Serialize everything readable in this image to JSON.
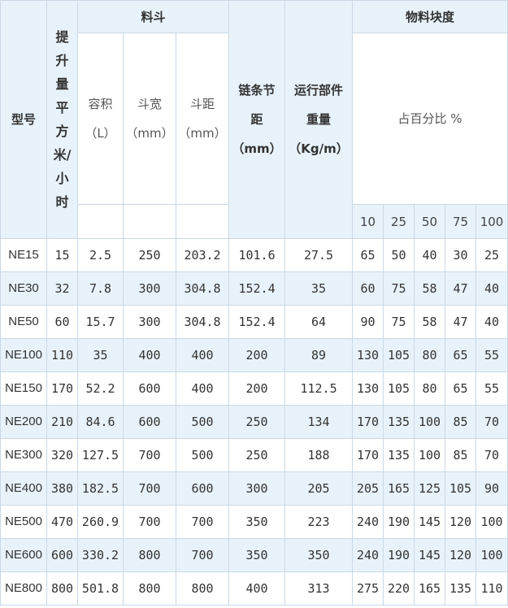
{
  "headers": {
    "model": "型号",
    "lift_chars": [
      "提",
      "升",
      "量",
      "平",
      "方",
      "米/",
      "小",
      "时"
    ],
    "hopper_group": "料斗",
    "volume": [
      "容积",
      "（L）"
    ],
    "width": [
      "斗宽",
      "（mm）"
    ],
    "spacing": [
      "斗距",
      "（mm）"
    ],
    "chain_pitch": [
      "链条节",
      "距",
      "（mm）"
    ],
    "weight": [
      "运行部件",
      "重量",
      "（Kg/m）"
    ],
    "lump_group": "物料块度",
    "percent": "占百分比 %",
    "percent_cols": [
      "10",
      "25",
      "50",
      "75",
      "100"
    ]
  },
  "rows": [
    [
      "NE15",
      "15",
      "2.5",
      "250",
      "203.2",
      "101.6",
      "27.5",
      "65",
      "50",
      "40",
      "30",
      "25"
    ],
    [
      "NE30",
      "32",
      "7.8",
      "300",
      "304.8",
      "152.4",
      "35",
      "60",
      "75",
      "58",
      "47",
      "40"
    ],
    [
      "NE50",
      "60",
      "15.7",
      "300",
      "304.8",
      "152.4",
      "64",
      "90",
      "75",
      "58",
      "47",
      "40"
    ],
    [
      "NE100",
      "110",
      "35",
      "400",
      "400",
      "200",
      "89",
      "130",
      "105",
      "80",
      "65",
      "55"
    ],
    [
      "NE150",
      "170",
      "52.2",
      "600",
      "400",
      "200",
      "112.5",
      "130",
      "105",
      "80",
      "65",
      "55"
    ],
    [
      "NE200",
      "210",
      "84.6",
      "600",
      "500",
      "250",
      "134",
      "170",
      "135",
      "100",
      "85",
      "70"
    ],
    [
      "NE300",
      "320",
      "127.5",
      "700",
      "500",
      "250",
      "188",
      "170",
      "135",
      "100",
      "85",
      "70"
    ],
    [
      "NE400",
      "380",
      "182.5",
      "700",
      "600",
      "300",
      "205",
      "205",
      "165",
      "125",
      "105",
      "90"
    ],
    [
      "NE500",
      "470",
      "260.9",
      "700",
      "700",
      "350",
      "223",
      "240",
      "190",
      "145",
      "120",
      "100"
    ],
    [
      "NE600",
      "600",
      "330.2",
      "800",
      "700",
      "350",
      "350",
      "240",
      "190",
      "145",
      "120",
      "100"
    ],
    [
      "NE800",
      "800",
      "501.8",
      "800",
      "800",
      "400",
      "313",
      "275",
      "220",
      "165",
      "135",
      "110"
    ]
  ]
}
